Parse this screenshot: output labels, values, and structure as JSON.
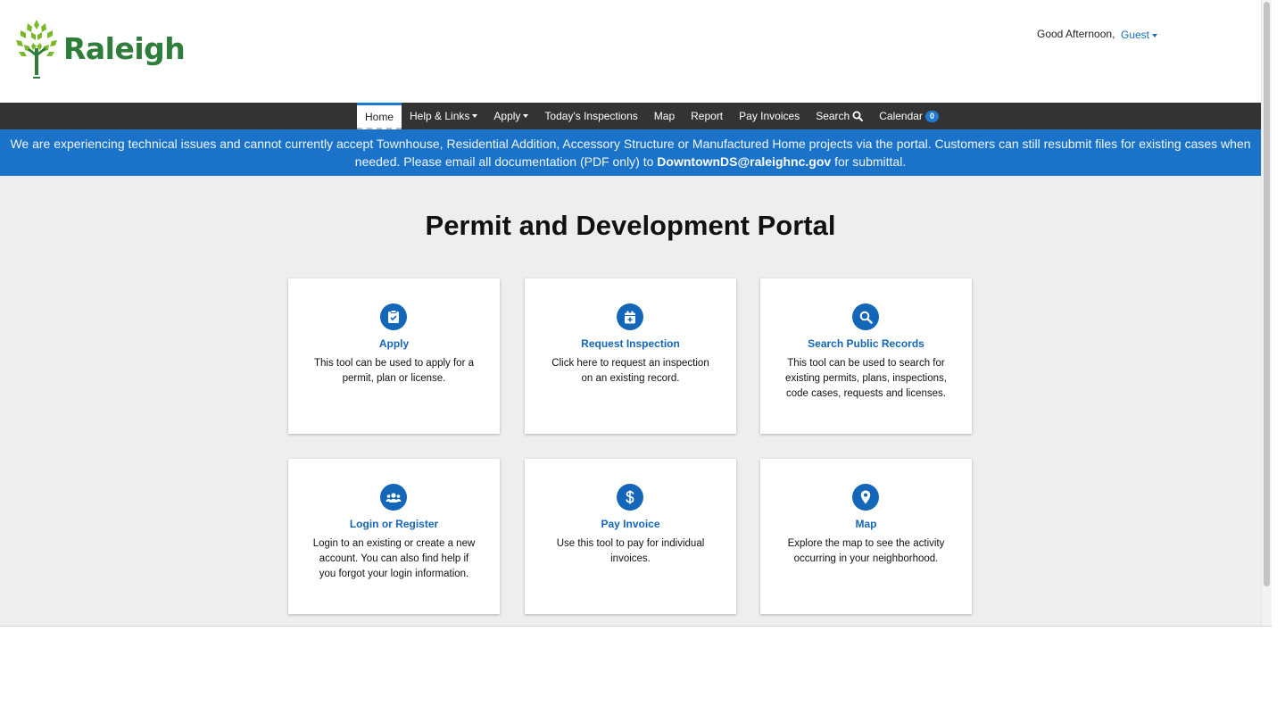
{
  "header": {
    "logo_text": "Raleigh",
    "greeting": "Good Afternoon,",
    "user": "Guest"
  },
  "nav": {
    "items": [
      {
        "label": "Home"
      },
      {
        "label": "Help & Links"
      },
      {
        "label": "Apply"
      },
      {
        "label": "Today's Inspections"
      },
      {
        "label": "Map"
      },
      {
        "label": "Report"
      },
      {
        "label": "Pay Invoices"
      },
      {
        "label": "Search"
      },
      {
        "label": "Calendar"
      }
    ],
    "calendar_count": "0"
  },
  "banner": {
    "text_before": "We are experiencing technical issues and cannot currently accept Townhouse, Residential Addition, Accessory Structure or Manufactured Home projects via the portal. Customers can still resubmit files for existing cases when needed. Please email all documentation (PDF only) to ",
    "email": "DowntownDS@raleighnc.gov",
    "text_after": " for submittal."
  },
  "main": {
    "title": "Permit and Development Portal",
    "cards": [
      {
        "title": "Apply",
        "desc": "This tool can be used to apply for a permit, plan or license.",
        "icon": "clipboard-check-icon"
      },
      {
        "title": "Request Inspection",
        "desc": "Click here to request an inspection on an existing record.",
        "icon": "calendar-plus-icon"
      },
      {
        "title": "Search Public Records",
        "desc": "This tool can be used to search for existing permits, plans, inspections, code cases, requests and licenses.",
        "icon": "search-icon"
      },
      {
        "title": "Login or Register",
        "desc": "Login to an existing or create a new account. You can also find help if you forgot your login information.",
        "icon": "users-icon"
      },
      {
        "title": "Pay Invoice",
        "desc": "Use this tool to pay for individual invoices.",
        "icon": "dollar-icon"
      },
      {
        "title": "Map",
        "desc": "Explore the map to see the activity occurring in your neighborhood.",
        "icon": "map-pin-icon"
      }
    ]
  },
  "colors": {
    "brand_green": "#2f7d3b",
    "accent_blue": "#1466b8",
    "banner_blue": "#1a73c9",
    "nav_dark": "#333333"
  }
}
